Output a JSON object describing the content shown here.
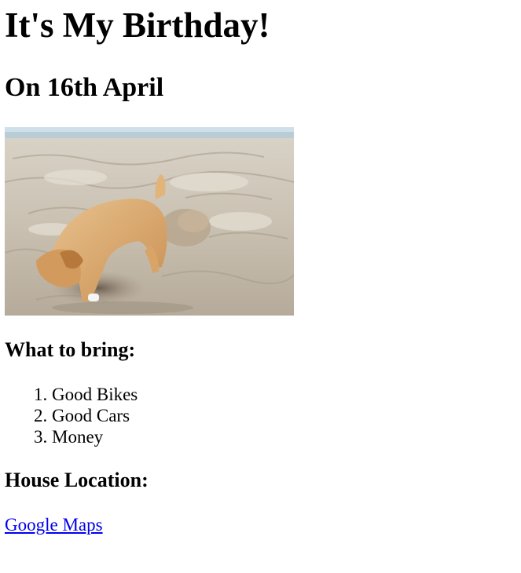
{
  "heading": "It's My Birthday!",
  "date_heading": "On 16th April",
  "image": {
    "alt": "Puppy digging in the sand on a beach",
    "icon": "puppy-digging-photo"
  },
  "bring": {
    "title": "What to bring:",
    "items": [
      "Good Bikes",
      "Good Cars",
      "Money"
    ]
  },
  "location": {
    "title": "House Location:",
    "link_label": "Google Maps"
  },
  "colors": {
    "link": "#0000ee",
    "text": "#000000",
    "background": "#ffffff"
  }
}
